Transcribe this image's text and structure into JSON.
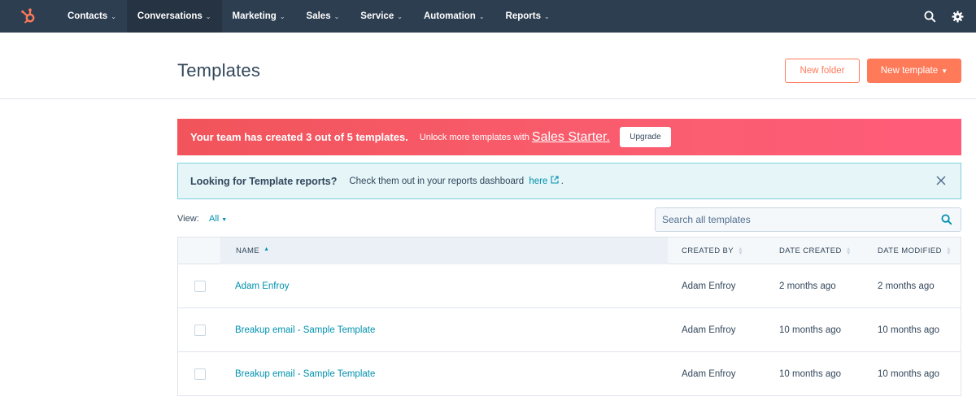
{
  "nav": {
    "logo_icon": "hubspot-sprocket-icon",
    "items": [
      {
        "label": "Contacts",
        "active": false
      },
      {
        "label": "Conversations",
        "active": true
      },
      {
        "label": "Marketing",
        "active": false
      },
      {
        "label": "Sales",
        "active": false
      },
      {
        "label": "Service",
        "active": false
      },
      {
        "label": "Automation",
        "active": false
      },
      {
        "label": "Reports",
        "active": false
      }
    ],
    "right_icons": [
      "search-icon",
      "settings-gear-icon"
    ]
  },
  "header": {
    "title": "Templates",
    "new_folder_label": "New folder",
    "new_template_label": "New template"
  },
  "upgrade_banner": {
    "strong": "Your team has created 3 out of 5 templates.",
    "text": "Unlock more templates with",
    "link": "Sales Starter.",
    "button": "Upgrade"
  },
  "info_banner": {
    "strong": "Looking for Template reports?",
    "text": "Check them out in your reports dashboard",
    "link": "here",
    "suffix": "."
  },
  "filter": {
    "view_label": "View:",
    "view_value": "All"
  },
  "search": {
    "placeholder": "Search all templates"
  },
  "table": {
    "columns": {
      "name": "NAME",
      "created_by": "CREATED BY",
      "date_created": "DATE CREATED",
      "date_modified": "DATE MODIFIED"
    },
    "rows": [
      {
        "name": "Adam Enfroy",
        "created_by": "Adam Enfroy",
        "date_created": "2 months ago",
        "date_modified": "2 months ago"
      },
      {
        "name": "Breakup email - Sample Template",
        "created_by": "Adam Enfroy",
        "date_created": "10 months ago",
        "date_modified": "10 months ago"
      },
      {
        "name": "Breakup email - Sample Template",
        "created_by": "Adam Enfroy",
        "date_created": "10 months ago",
        "date_modified": "10 months ago"
      }
    ]
  },
  "colors": {
    "nav_bg": "#2d3e50",
    "accent_orange": "#ff7a59",
    "link_teal": "#0091ae",
    "banner_pink": "#f2545b"
  }
}
